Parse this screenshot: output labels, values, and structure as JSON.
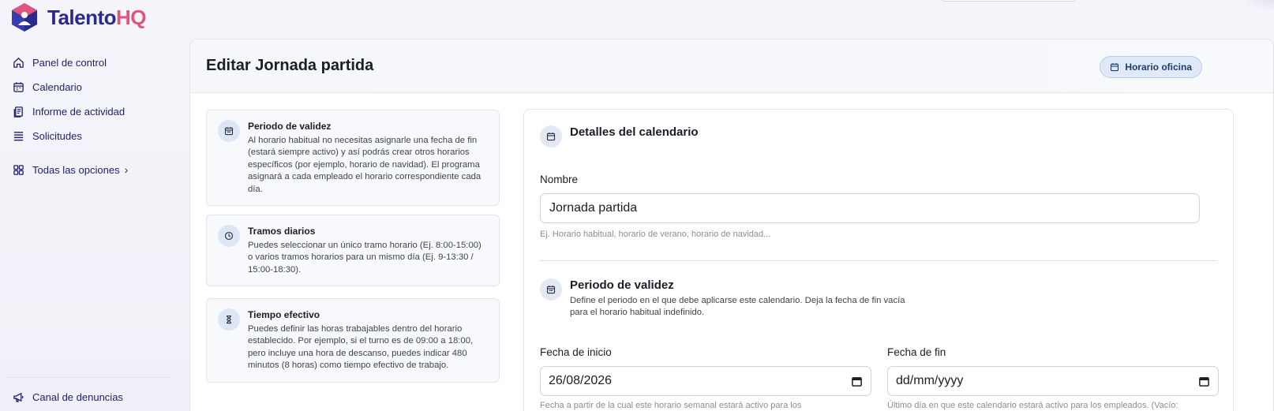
{
  "brand": {
    "name_part1": "Talento",
    "name_part2": "HQ"
  },
  "sidebar": {
    "items": [
      {
        "label": "Panel de control",
        "icon": "home-icon"
      },
      {
        "label": "Calendario",
        "icon": "calendar-icon"
      },
      {
        "label": "Informe de actividad",
        "icon": "report-icon"
      },
      {
        "label": "Solicitudes",
        "icon": "list-icon"
      }
    ],
    "all_options": {
      "label": "Todas las opciones",
      "chevron": "›",
      "icon": "grid-icon"
    },
    "footer": {
      "label": "Canal de denuncias",
      "icon": "megaphone-icon"
    }
  },
  "header": {
    "title": "Editar Jornada partida",
    "badge": "Horario oficina"
  },
  "info_cards": [
    {
      "title": "Periodo de validez",
      "text": "Al horario habitual no necesitas asignarle una fecha de fin (estará siempre activo) y así podrás crear otros horarios específicos (por ejemplo, horario de navidad). El programa asignará a cada empleado el horario correspondiente cada día.",
      "icon": "calendar-icon"
    },
    {
      "title": "Tramos diarios",
      "text": "Puedes seleccionar un único tramo horario (Ej. 8:00-15:00) o varios tramos horarios para un mismo día (Ej. 9-13:30 / 15:00-18:30).",
      "icon": "clock-icon"
    },
    {
      "title": "Tiempo efectivo",
      "text": "Puedes definir las horas trabajables dentro del horario establecido. Por ejemplo, si el turno es de 09:00 a 18:00, pero incluye una hora de descanso, puedes indicar 480 minutos (8 horas) como tiempo efectivo de trabajo.",
      "icon": "hourglass-icon"
    }
  ],
  "form": {
    "details": {
      "title": "Detalles del calendario",
      "name_label": "Nombre",
      "name_value": "Jornada partida",
      "name_hint": "Ej. Horario habitual, horario de verano, horario de navidad..."
    },
    "validity": {
      "title": "Periodo de validez",
      "description": "Define el periodo en el que debe aplicarse este calendario. Deja la fecha de fin vacía para el horario habitual indefinido.",
      "start_label": "Fecha de inicio",
      "start_value": "26/08/2026",
      "start_hint": "Fecha a partir de la cual este horario semanal estará activo para los",
      "end_label": "Fecha de fin",
      "end_placeholder": "dd/mm/yyyy",
      "end_hint": "Último día en que este calendario estará activo para los empleados. (Vacío:"
    }
  },
  "colors": {
    "brand_primary": "#2a2a8c",
    "brand_accent": "#e0567a",
    "nav_text": "#1d1f6b",
    "badge_bg": "#dfe9f7"
  }
}
